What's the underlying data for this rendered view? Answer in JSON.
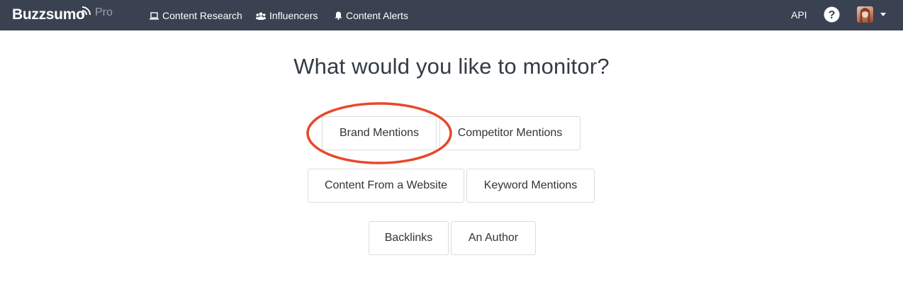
{
  "navbar": {
    "brand": "Buzzsumo",
    "brand_suffix": "Pro",
    "items": [
      {
        "label": "Content Research",
        "icon": "laptop-icon"
      },
      {
        "label": "Influencers",
        "icon": "users-icon"
      },
      {
        "label": "Content Alerts",
        "icon": "bell-icon"
      }
    ],
    "api_label": "API",
    "help_icon": "question-circle-icon",
    "avatar_icon": "user-avatar"
  },
  "main": {
    "heading": "What would you like to monitor?",
    "options": [
      {
        "label": "Brand Mentions"
      },
      {
        "label": "Competitor Mentions"
      },
      {
        "label": "Content From a Website"
      },
      {
        "label": "Keyword Mentions"
      },
      {
        "label": "Backlinks"
      },
      {
        "label": "An Author"
      }
    ]
  },
  "colors": {
    "navbar_bg": "#3a4150",
    "annotation_circle": "#e8472a",
    "button_border": "#dcdcdc",
    "heading_text": "#333b44"
  }
}
